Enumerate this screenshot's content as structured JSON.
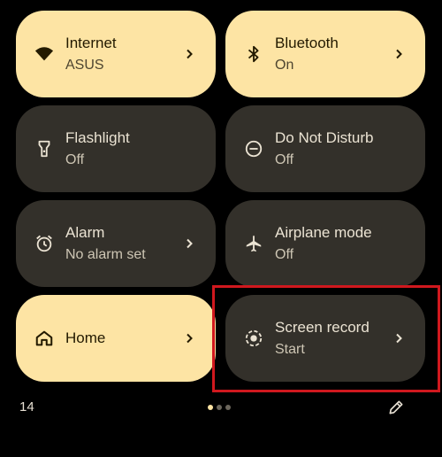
{
  "tiles": [
    {
      "label": "Internet",
      "sub": "ASUS",
      "state": "on",
      "icon": "wifi-icon",
      "chevron": true
    },
    {
      "label": "Bluetooth",
      "sub": "On",
      "state": "on",
      "icon": "bluetooth-icon",
      "chevron": true
    },
    {
      "label": "Flashlight",
      "sub": "Off",
      "state": "off",
      "icon": "flashlight-icon",
      "chevron": false
    },
    {
      "label": "Do Not Disturb",
      "sub": "Off",
      "state": "off",
      "icon": "do-not-disturb-icon",
      "chevron": false
    },
    {
      "label": "Alarm",
      "sub": "No alarm set",
      "state": "off",
      "icon": "alarm-icon",
      "chevron": true
    },
    {
      "label": "Airplane mode",
      "sub": "Off",
      "state": "off",
      "icon": "airplane-icon",
      "chevron": false
    },
    {
      "label": "Home",
      "sub": "",
      "state": "on",
      "icon": "home-icon",
      "chevron": true
    },
    {
      "label": "Screen record",
      "sub": "Start",
      "state": "off",
      "icon": "screen-record-icon",
      "chevron": true
    }
  ],
  "footer": {
    "page_number": "14",
    "page_dots": {
      "count": 3,
      "active_index": 0
    },
    "edit_icon": "pencil-icon"
  },
  "colors": {
    "tile_on": "#fde4a4",
    "tile_off": "#33302a",
    "highlight": "#d0181e",
    "background": "#000000"
  }
}
